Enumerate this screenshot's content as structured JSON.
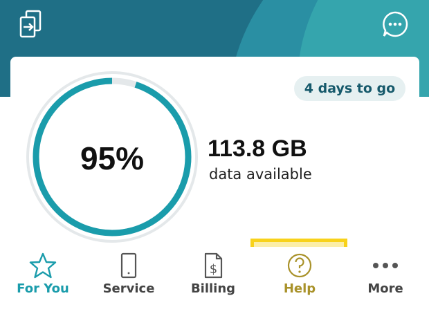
{
  "header": {
    "left_icon": "switch-device-icon",
    "right_icon": "chat-bubble-icon"
  },
  "usage": {
    "percent_label": "95%",
    "percent_value": 95,
    "days_badge": "4 days to go",
    "data_amount": "113.8 GB",
    "data_caption": "data available"
  },
  "nav": {
    "items": [
      {
        "label": "For You",
        "icon": "star-icon",
        "active": true
      },
      {
        "label": "Service",
        "icon": "device-icon",
        "active": false
      },
      {
        "label": "Billing",
        "icon": "bill-icon",
        "active": false
      },
      {
        "label": "Help",
        "icon": "help-icon",
        "active": false
      },
      {
        "label": "More",
        "icon": "more-dots-icon",
        "active": false
      }
    ]
  },
  "colors": {
    "header_dark": "#1f6f86",
    "accent_teal": "#1a9cab",
    "ring_track": "#e4e8ea",
    "highlight_border": "#f8d21b",
    "highlight_fill": "#fbeea8"
  }
}
